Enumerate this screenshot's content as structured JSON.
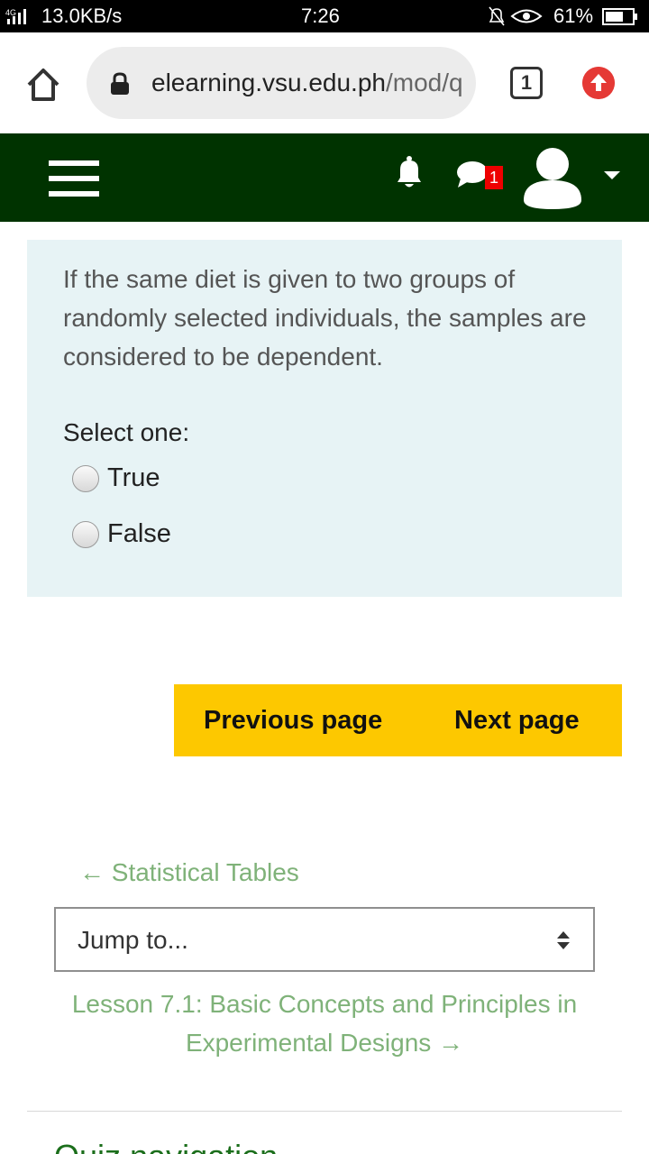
{
  "status_bar": {
    "network": "4G",
    "speed": "13.0KB/s",
    "time": "7:26",
    "battery": "61%"
  },
  "browser": {
    "url_domain": "elearning.vsu.edu.ph",
    "url_path": "/mod/q",
    "tab_count": "1"
  },
  "header": {
    "message_badge": "1"
  },
  "question": {
    "text": "If the same diet is given to two groups of randomly selected individuals, the samples are considered to be dependent.",
    "prompt": "Select one:",
    "options": [
      "True",
      "False"
    ]
  },
  "page_nav": {
    "previous_label": "Previous page",
    "next_label": "Next page"
  },
  "activity_nav": {
    "previous_link": "← Statistical Tables",
    "jump_placeholder": "Jump to...",
    "next_link": "Lesson 7.1: Basic Concepts and Principles in Experimental Designs →"
  },
  "quiz_navigation": {
    "title": "Quiz navigation"
  },
  "colors": {
    "header_bg": "#003300",
    "nav_button_bg": "#fdc800",
    "question_bg": "#e7f3f5",
    "link_color": "#7fb279"
  }
}
